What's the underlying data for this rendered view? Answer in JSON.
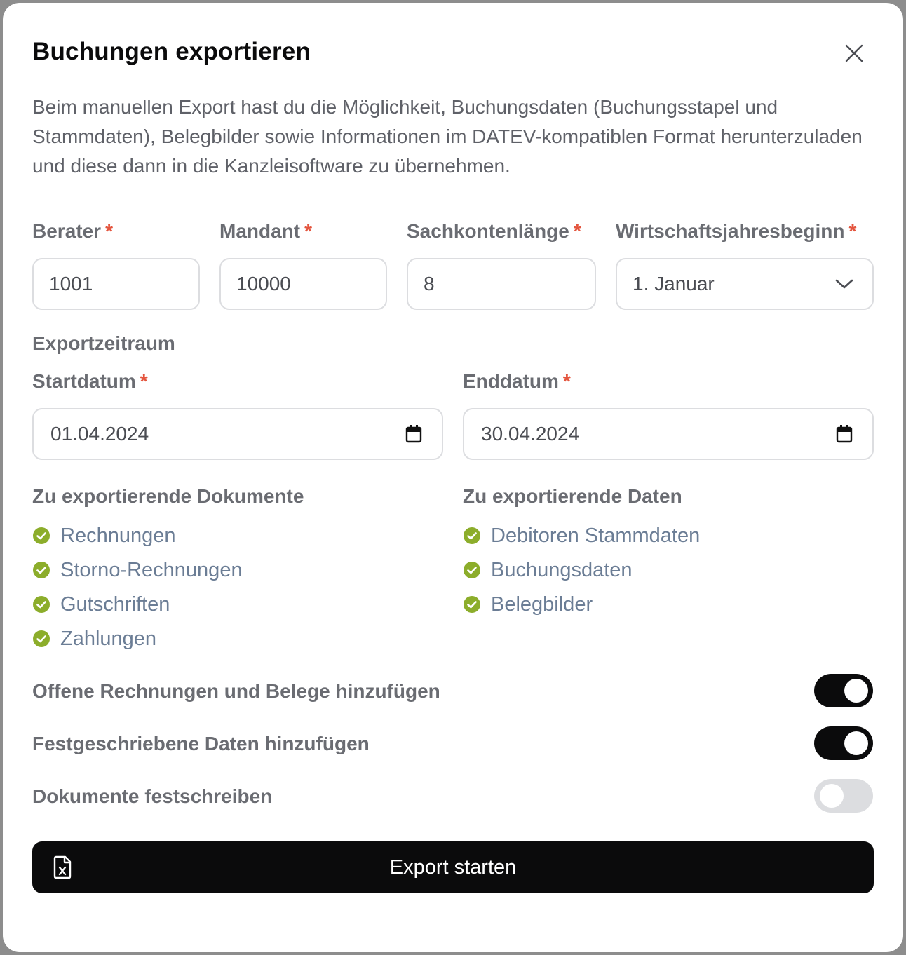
{
  "dialog": {
    "title": "Buchungen exportieren",
    "description": "Beim manuellen Export hast du die Möglichkeit, Buchungsdaten (Buchungsstapel und Stammdaten), Belegbilder sowie Informationen im DATEV-kompatiblen Format herunterzuladen und diese dann in die Kanzleisoftware zu übernehmen."
  },
  "fields": {
    "berater": {
      "label": "Berater",
      "value": "1001"
    },
    "mandant": {
      "label": "Mandant",
      "value": "10000"
    },
    "sachkontenlaenge": {
      "label": "Sachkontenlänge",
      "value": "8"
    },
    "wirtschaftsjahresbeginn": {
      "label": "Wirtschaftsjahresbeginn",
      "value": "1. Januar"
    }
  },
  "required_marker": "*",
  "exportzeitraum": {
    "heading": "Exportzeitraum",
    "start": {
      "label": "Startdatum",
      "value": "01.04.2024"
    },
    "end": {
      "label": "Enddatum",
      "value": "30.04.2024"
    }
  },
  "documents": {
    "heading": "Zu exportierende Dokumente",
    "items": [
      "Rechnungen",
      "Storno-Rechnungen",
      "Gutschriften",
      "Zahlungen"
    ]
  },
  "data": {
    "heading": "Zu exportierende Daten",
    "items": [
      "Debitoren Stammdaten",
      "Buchungsdaten",
      "Belegbilder"
    ]
  },
  "toggles": [
    {
      "label": "Offene Rechnungen und Belege hinzufügen",
      "on": true
    },
    {
      "label": "Festgeschriebene Daten hinzufügen",
      "on": true
    },
    {
      "label": "Dokumente festschreiben",
      "on": false
    }
  ],
  "export_button": {
    "label": "Export starten",
    "icon": "file-excel-icon"
  },
  "icons": {
    "close": "close-icon",
    "dropdown": "chevron-down-icon",
    "calendar": "calendar-icon",
    "check": "check-circle-icon"
  },
  "colors": {
    "accent": "#0b0b0c",
    "check": "#8cad2b",
    "required": "#e4553e",
    "item_text": "#6b7d95"
  }
}
